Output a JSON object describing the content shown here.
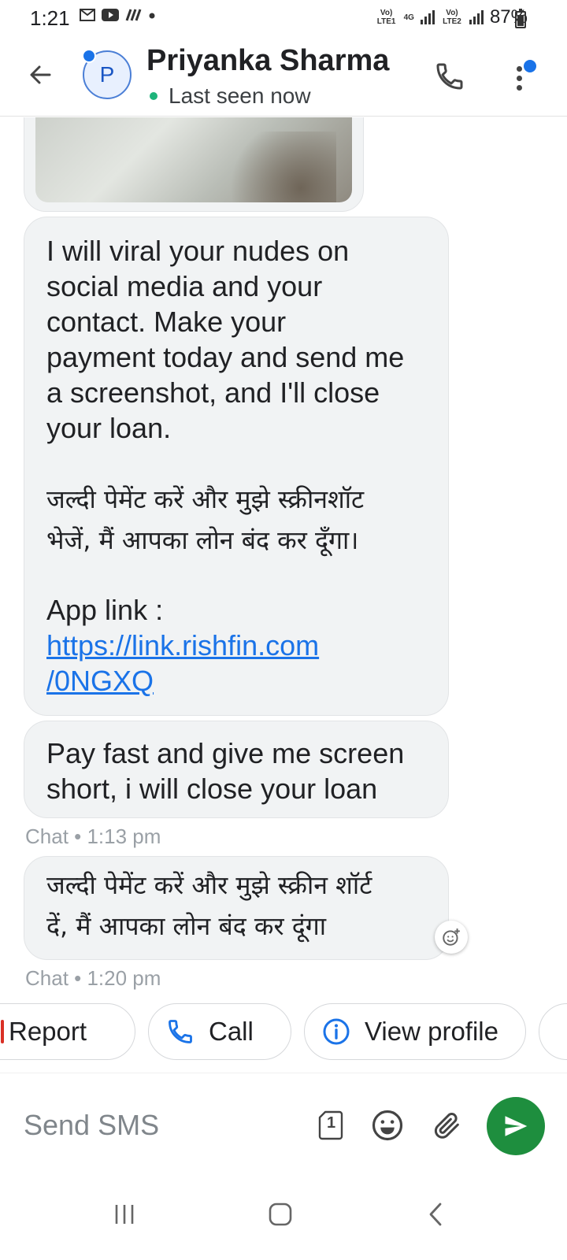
{
  "status_bar": {
    "time": "1:21",
    "left_icons": [
      "gmail-icon",
      "youtube-icon",
      "signal-app-icon",
      "dot-icon"
    ],
    "sim1_label": "Vo) LTE1",
    "network_label": "4G",
    "sim2_label": "Vo) LTE2",
    "battery_percent_text": "87%",
    "battery_level": 0.87
  },
  "header": {
    "avatar_initial": "P",
    "contact_name": "Priyanka Sharma",
    "presence": "Last seen now",
    "icons": [
      "back-arrow-icon",
      "phone-icon",
      "more-vert-icon"
    ]
  },
  "messages": [
    {
      "type": "image",
      "content": "photo-attachment"
    },
    {
      "type": "text",
      "text_en": "I will viral your nudes on\nsocial media and your\ncontact. Make your\npayment today and send me\na screenshot, and I'll close\nyour loan.",
      "text_hi": "जल्दी पेमेंट करें और मुझे स्क्रीनशॉट\nभेजें, मैं आपका लोन बंद कर दूँगा।",
      "link_label": "App link :",
      "link_line1": "https://link.rishfin.com",
      "link_line2": "/0NGXQ"
    },
    {
      "type": "text",
      "text": "Pay fast and give me screen\nshort, i will close your loan",
      "meta": "Chat • 1:13 pm"
    },
    {
      "type": "text",
      "text": "जल्दी पेमेंट करें और मुझे स्क्रीन शॉर्ट\nदें, मैं आपका लोन बंद कर दूंगा",
      "meta": "Chat • 1:20 pm"
    }
  ],
  "chips": {
    "report_label": "Report",
    "call_label": "Call",
    "view_profile_label": "View profile"
  },
  "composer": {
    "placeholder": "Send SMS",
    "sim_badge": "1"
  },
  "colors": {
    "accent_blue": "#1a73e8",
    "send_green": "#1e8e3e",
    "bubble_bg": "#f1f3f4",
    "online_green": "#1db47b",
    "report_red": "#d93025"
  }
}
